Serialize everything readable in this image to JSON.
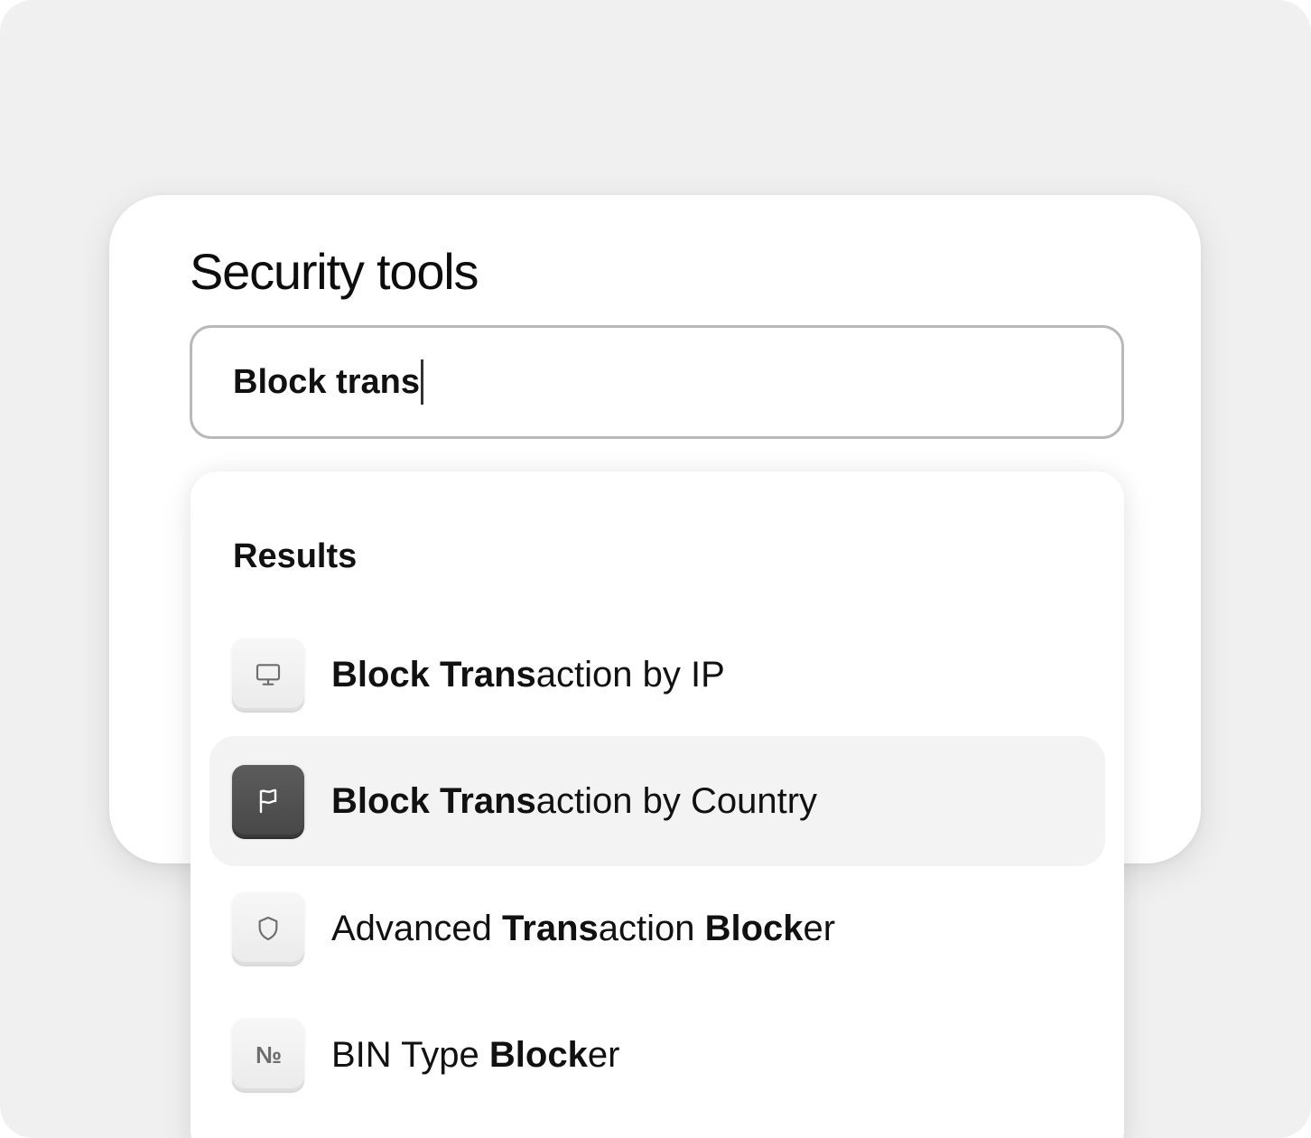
{
  "page": {
    "title": "Security tools"
  },
  "search": {
    "value": "Block trans"
  },
  "results": {
    "heading": "Results",
    "items": [
      {
        "icon": "monitor-icon",
        "segments": [
          {
            "text": "Block Trans",
            "bold": true
          },
          {
            "text": "action by IP",
            "bold": false
          }
        ],
        "selected": false
      },
      {
        "icon": "flag-icon",
        "segments": [
          {
            "text": "Block Trans",
            "bold": true
          },
          {
            "text": "action by Country",
            "bold": false
          }
        ],
        "selected": true
      },
      {
        "icon": "shield-icon",
        "segments": [
          {
            "text": "Advanced ",
            "bold": false
          },
          {
            "text": "Trans",
            "bold": true
          },
          {
            "text": "action ",
            "bold": false
          },
          {
            "text": "Block",
            "bold": true
          },
          {
            "text": "er",
            "bold": false
          }
        ],
        "selected": false
      },
      {
        "icon": "numero-icon",
        "icon_glyph": "№",
        "segments": [
          {
            "text": "BIN Type ",
            "bold": false
          },
          {
            "text": "Block",
            "bold": true
          },
          {
            "text": "er",
            "bold": false
          }
        ],
        "selected": false
      }
    ]
  },
  "colors": {
    "background": "#f0f0f0",
    "panel": "#ffffff",
    "selected_row": "#f3f3f3",
    "selected_icon": "#4f4f4f",
    "input_border": "#b9b9b9"
  }
}
